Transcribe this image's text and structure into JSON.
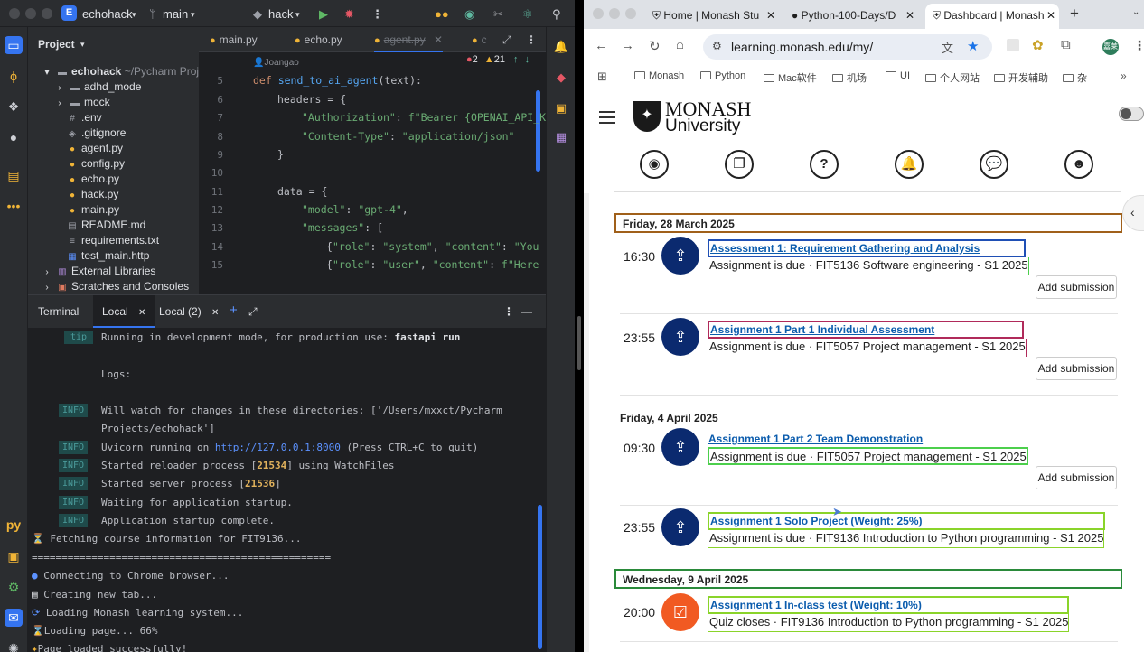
{
  "ide": {
    "project_name": "echohack",
    "branch": "main",
    "run_config": "hack",
    "panel_title": "Project",
    "tree": [
      {
        "label": "echohack",
        "suffix": "~/Pycharm Proje",
        "icon": "folder-icon"
      },
      {
        "label": "adhd_mode",
        "icon": "folder-icon"
      },
      {
        "label": "mock",
        "icon": "folder-icon"
      },
      {
        "label": ".env",
        "icon": "env-file-icon"
      },
      {
        "label": ".gitignore",
        "icon": "gitignore-icon"
      },
      {
        "label": "agent.py",
        "icon": "python-file-icon"
      },
      {
        "label": "config.py",
        "icon": "python-file-icon"
      },
      {
        "label": "echo.py",
        "icon": "python-file-icon"
      },
      {
        "label": "hack.py",
        "icon": "python-file-icon"
      },
      {
        "label": "main.py",
        "icon": "python-file-icon"
      },
      {
        "label": "README.md",
        "icon": "markdown-file-icon"
      },
      {
        "label": "requirements.txt",
        "icon": "text-file-icon"
      },
      {
        "label": "test_main.http",
        "icon": "http-file-icon"
      },
      {
        "label": "External Libraries",
        "icon": "library-icon"
      },
      {
        "label": "Scratches and Consoles",
        "icon": "scratches-icon"
      }
    ],
    "editor_tabs": [
      "main.py",
      "echo.py",
      "agent.py",
      "c"
    ],
    "author": "Joangao",
    "inspections": {
      "errors": "2",
      "warnings": "21"
    },
    "line_numbers": [
      "5",
      "6",
      "7",
      "8",
      "9",
      "10",
      "11",
      "12",
      "13",
      "14",
      "15"
    ],
    "code": {
      "l5": {
        "kw": "def ",
        "fn": "send_to_ai_agent",
        "rest": "(text):"
      },
      "l6": "headers = {",
      "l7": {
        "key": "\"Authorization\"",
        "sep": ": ",
        "val": "f\"Bearer {OPENAI_API_KE"
      },
      "l8": {
        "key": "\"Content-Type\"",
        "sep": ": ",
        "val": "\"application/json\""
      },
      "l9": "}",
      "l11": "data = {",
      "l12": {
        "key": "\"model\"",
        "sep": ": ",
        "val": "\"gpt-4\"",
        "end": ","
      },
      "l13": {
        "key": "\"messages\"",
        "sep": ": ["
      },
      "l14": {
        "pre": "{",
        "key": "\"role\"",
        "sep": ": ",
        "val": "\"system\"",
        "sep2": ", ",
        "key2": "\"content\"",
        "sep3": ": ",
        "val2": "\"You a"
      },
      "l15": {
        "pre": "{",
        "key": "\"role\"",
        "sep": ": ",
        "val": "\"user\"",
        "sep2": ", ",
        "key2": "\"content\"",
        "sep3": ": ",
        "val2": "f\"Here is"
      }
    },
    "terminal": {
      "tabs": [
        "Terminal",
        "Local",
        "Local (2)"
      ],
      "tip_badge": "tip",
      "info_badge": "INFO",
      "tip_line": {
        "text": "Running in development mode, for production use: ",
        "bold": "fastapi run"
      },
      "logs": "Logs:",
      "watch_line": "Will watch for changes in these directories: ['/Users/mxxct/Pycharm",
      "watch_line2": "Projects/echohack']",
      "uvicorn_pre": "Uvicorn running on ",
      "uvicorn_url": "http://127.0.0.1:8000",
      "uvicorn_post": " (Press CTRL+C to quit)",
      "reloader_pre": "Started reloader process [",
      "reloader_pid": "21534",
      "reloader_post": "] using WatchFiles",
      "server_pre": "Started server process [",
      "server_pid": "21536",
      "server_post": "]",
      "waiting": "Waiting for application startup.",
      "complete": "Application startup complete.",
      "fetching": "Fetching course information for FIT9136...",
      "rule": "==================================================",
      "connecting": "Connecting to Chrome browser...",
      "newtab": "Creating new tab...",
      "loading_system": "Loading Monash learning system...",
      "loading_page": "Loading page... 66%",
      "loaded": "Page loaded successfully!"
    },
    "tool_windows": [
      "project-icon",
      "commit-icon",
      "structure-icon",
      "github-icon",
      "bookmarks-icon",
      "more-icon",
      "python-console-icon",
      "problems-icon",
      "services-icon",
      "terminal-icon",
      "git-icon"
    ]
  },
  "browser": {
    "tabs": [
      {
        "title": "Home | Monash Stu",
        "icon": "monash-icon"
      },
      {
        "title": "Python-100-Days/D",
        "icon": "github-icon"
      },
      {
        "title": "Dashboard | Monash",
        "icon": "monash-icon",
        "active": true
      }
    ],
    "url": "learning.monash.edu/my/",
    "bookmarks": [
      "Monash",
      "Python",
      "Mac软件",
      "机场",
      "UI",
      "个人网站",
      "开发辅助",
      "杂"
    ],
    "profile_initials": "嘉莱",
    "site": {
      "logo_top": "MONASH",
      "logo_bottom": "University"
    },
    "nav_icons": [
      "search-icon",
      "book-icon",
      "help-icon",
      "notifications-icon",
      "messages-icon",
      "user-icon"
    ],
    "days": [
      {
        "label": "Friday, 28 March 2025"
      },
      {
        "label": "Friday, 4 April 2025"
      },
      {
        "label": "Wednesday, 9 April 2025"
      }
    ],
    "events": [
      {
        "time": "16:30",
        "title": "Assessment 1: Requirement Gathering and Analysis",
        "subtitle": "Assignment is due · FIT5136 Software engineering - S1 2025",
        "action": "Add submission",
        "icon": "assignment-icon"
      },
      {
        "time": "23:55",
        "title": "Assignment 1 Part 1 Individual Assessment",
        "subtitle": "Assignment is due · FIT5057 Project management - S1 2025",
        "action": "Add submission",
        "icon": "assignment-icon"
      },
      {
        "time": "09:30",
        "title": "Assignment 1 Part 2 Team Demonstration",
        "subtitle": "Assignment is due · FIT5057 Project management - S1 2025",
        "action": "Add submission",
        "icon": "assignment-icon"
      },
      {
        "time": "23:55",
        "title": "Assignment 1 Solo Project (Weight: 25%)",
        "subtitle": "Assignment is due · FIT9136 Introduction to Python programming - S1 2025",
        "icon": "assignment-icon"
      },
      {
        "time": "20:00",
        "title": "Assignment 1 In-class test (Weight: 10%)",
        "subtitle": "Quiz closes · FIT9136 Introduction to Python programming - S1 2025",
        "icon": "quiz-icon"
      }
    ],
    "colors": {
      "monash_blue": "#0b2a6f",
      "link": "#0b5cad",
      "quiz_orange": "#f15a22",
      "box_blue": "#1f4fb5",
      "box_red": "#b02a5a",
      "box_green": "#4ccf4c",
      "box_lime": "#8ad42a",
      "day_brown": "#a0601a",
      "day_green": "#2a8a3a"
    }
  }
}
